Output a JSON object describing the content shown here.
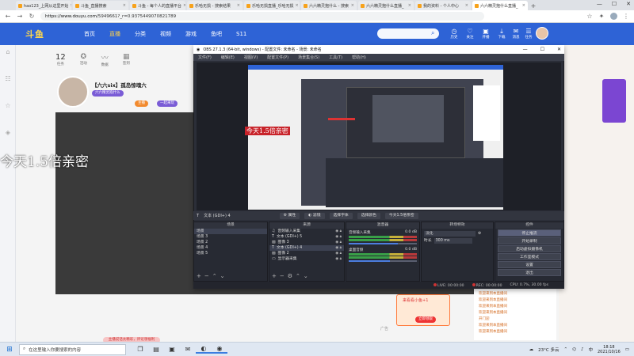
{
  "browser": {
    "tabs": [
      {
        "label": "hao123_上网从这里开始",
        "active": false
      },
      {
        "label": "斗鱼_直播搜索",
        "active": false
      },
      {
        "label": "斗鱼 - 每个人的直播平台",
        "active": false
      },
      {
        "label": "乐哈无损 - 搜索结果",
        "active": false
      },
      {
        "label": "乐哈无损直播_乐哈无损",
        "active": false
      },
      {
        "label": "六六精灵抱什么 - 搜索",
        "active": false
      },
      {
        "label": "六六精灵抱什么直播_",
        "active": false
      },
      {
        "label": "我的资料 - 个人中心",
        "active": false
      },
      {
        "label": "六六精灵抱什么直播_",
        "active": true
      }
    ],
    "new_tab": "+",
    "url_host": "https://www.douyu.com",
    "url_path": "/5949661?_r=0.9375449070821789"
  },
  "site": {
    "logo": "斗鱼",
    "nav": [
      {
        "label": "首页",
        "hot": false
      },
      {
        "label": "直播",
        "hot": true
      },
      {
        "label": "分类",
        "hot": false
      },
      {
        "label": "视频",
        "hot": false
      },
      {
        "label": "游戏",
        "hot": false
      },
      {
        "label": "鱼吧",
        "hot": false
      },
      {
        "label": "S11",
        "hot": false
      }
    ],
    "header_icons": [
      "历史",
      "关注",
      "开播",
      "下载",
      "消息",
      "任务"
    ],
    "stats": [
      {
        "num": "12",
        "label": "任务"
      },
      {
        "num": "",
        "label": "活动"
      },
      {
        "num": "",
        "label": "数据"
      },
      {
        "num": "",
        "label": "签到"
      }
    ],
    "room_title": "【六六six】孤岛惊魂六",
    "badges": [
      "六六精灵抱什么",
      "主播",
      "一起来玩"
    ],
    "overlay_text": "今天1.5倍亲密",
    "chat": [
      "欢迎来到本直播间",
      "欢迎来到本直播间",
      "欢迎来到本直播间",
      "欢迎来到本直播间",
      "开门迎",
      "欢迎来到本直播间",
      "欢迎来到本直播间"
    ],
    "promo_text": "来看看小鱼+1",
    "promo_btn": "立即领取",
    "ad_label": "广告",
    "bottom_tip": "主播说话太精彩，评论领福利"
  },
  "obs": {
    "title": "OBS 27.1.3 (64-bit, windows) - 配置文件: 未命名 - 场景: 未命名",
    "menu": [
      "文件(F)",
      "编辑(E)",
      "视图(V)",
      "配置文件(P)",
      "场景集合(S)",
      "工具(T)",
      "帮助(H)"
    ],
    "caption": "今天1.5倍亲密",
    "source_label": "文本 (GDI+) 4",
    "source_buttons": [
      "属性",
      "滤镜",
      "选择字体",
      "选择颜色",
      "今天1.5倍亲密"
    ],
    "docks": {
      "scenes": {
        "title": "场景",
        "items": [
          "场景",
          "场景 3",
          "场景 2",
          "场景 4",
          "场景 5"
        ],
        "selected": 0
      },
      "sources": {
        "title": "来源",
        "items": [
          {
            "label": "音频输入采集",
            "icon": "mic"
          },
          {
            "label": "文本 (GDI+) 5",
            "icon": "text"
          },
          {
            "label": "图像 3",
            "icon": "image"
          },
          {
            "label": "文本 (GDI+) 4",
            "icon": "text"
          },
          {
            "label": "图像 2",
            "icon": "image"
          },
          {
            "label": "显示器采集",
            "icon": "monitor"
          }
        ],
        "selected": 3
      },
      "mixer": {
        "title": "混音器",
        "channels": [
          {
            "name": "音频输入采集",
            "db": "0.0 dB",
            "level": 0.72
          },
          {
            "name": "桌面音频",
            "db": "0.0 dB",
            "level": 0.6
          }
        ]
      },
      "transitions": {
        "title": "转场特效",
        "type": "淡化",
        "duration_label": "时长",
        "duration": "300 ms"
      },
      "controls": {
        "title": "控件",
        "buttons": [
          "停止推流",
          "开始录制",
          "启动虚拟摄像机",
          "工作室模式",
          "设置",
          "退出"
        ]
      }
    },
    "status": {
      "live": "LIVE: 00:00:00",
      "rec": "REC: 00:00:00",
      "cpu": "CPU: 0.7%, 30.00 fps"
    }
  },
  "taskbar": {
    "search_placeholder": "在这里输入你要搜索的内容",
    "temp": "23°C 多云",
    "lang": "中",
    "time": "18:18",
    "date": "2021/10/16"
  },
  "colors": {
    "brand": "#2e63d6",
    "obs_bg": "#2b2e38",
    "caption_red": "#c8232a"
  }
}
